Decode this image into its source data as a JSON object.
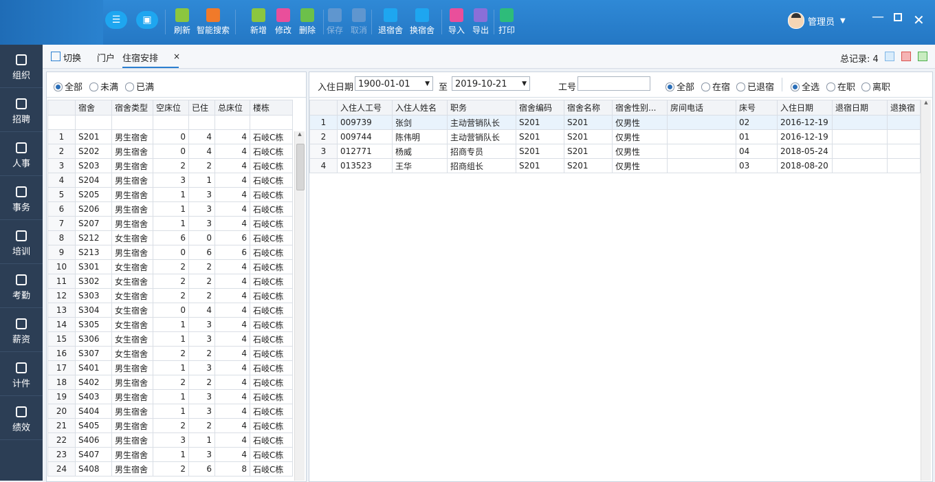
{
  "toolbar": {
    "items": [
      {
        "label": "刷新",
        "icon": "refresh-icon",
        "color": "#8cc63f",
        "enabled": true
      },
      {
        "label": "智能搜索",
        "icon": "filter-icon",
        "color": "#f07a2a",
        "enabled": true
      },
      {
        "label": "新增",
        "icon": "plus-icon",
        "color": "#8cc63f",
        "enabled": true
      },
      {
        "label": "修改",
        "icon": "pencil-icon",
        "color": "#e94f9b",
        "enabled": true
      },
      {
        "label": "删除",
        "icon": "x-icon",
        "color": "#6cc04a",
        "enabled": true
      },
      {
        "label": "保存",
        "icon": "save-icon",
        "color": "#5f96cf",
        "enabled": false
      },
      {
        "label": "取消",
        "icon": "cancel-icon",
        "color": "#5f96cf",
        "enabled": false
      },
      {
        "label": "退宿舍",
        "icon": "checkout-icon",
        "color": "#1ea6f0",
        "enabled": true
      },
      {
        "label": "换宿舍",
        "icon": "swap-icon",
        "color": "#1ea6f0",
        "enabled": true
      },
      {
        "label": "导入",
        "icon": "import-icon",
        "color": "#e94f9b",
        "enabled": true
      },
      {
        "label": "导出",
        "icon": "export-icon",
        "color": "#8a6fd8",
        "enabled": true
      },
      {
        "label": "打印",
        "icon": "print-icon",
        "color": "#2ebc7a",
        "enabled": true
      }
    ]
  },
  "user": {
    "name": "管理员"
  },
  "sidebar": {
    "items": [
      {
        "label": "组织"
      },
      {
        "label": "招聘"
      },
      {
        "label": "人事"
      },
      {
        "label": "事务"
      },
      {
        "label": "培训"
      },
      {
        "label": "考勤"
      },
      {
        "label": "薪资"
      },
      {
        "label": "计件"
      },
      {
        "label": "绩效"
      }
    ]
  },
  "tabs": {
    "switch": "切换",
    "portal": "门户",
    "active": "住宿安排",
    "close": "×"
  },
  "total": {
    "label": "总记录: 4"
  },
  "left": {
    "filter": {
      "all": "全部",
      "not_full": "未满",
      "full": "已满"
    },
    "columns": [
      "宿舍",
      "宿舍类型",
      "空床位",
      "已住",
      "总床位",
      "楼栋"
    ],
    "rows": [
      [
        "1",
        "S201",
        "男生宿舍",
        "0",
        "4",
        "4",
        "石岐C栋"
      ],
      [
        "2",
        "S202",
        "男生宿舍",
        "0",
        "4",
        "4",
        "石岐C栋"
      ],
      [
        "3",
        "S203",
        "男生宿舍",
        "2",
        "2",
        "4",
        "石岐C栋"
      ],
      [
        "4",
        "S204",
        "男生宿舍",
        "3",
        "1",
        "4",
        "石岐C栋"
      ],
      [
        "5",
        "S205",
        "男生宿舍",
        "1",
        "3",
        "4",
        "石岐C栋"
      ],
      [
        "6",
        "S206",
        "男生宿舍",
        "1",
        "3",
        "4",
        "石岐C栋"
      ],
      [
        "7",
        "S207",
        "男生宿舍",
        "1",
        "3",
        "4",
        "石岐C栋"
      ],
      [
        "8",
        "S212",
        "女生宿舍",
        "6",
        "0",
        "6",
        "石岐C栋"
      ],
      [
        "9",
        "S213",
        "男生宿舍",
        "0",
        "6",
        "6",
        "石岐C栋"
      ],
      [
        "10",
        "S301",
        "女生宿舍",
        "2",
        "2",
        "4",
        "石岐C栋"
      ],
      [
        "11",
        "S302",
        "女生宿舍",
        "2",
        "2",
        "4",
        "石岐C栋"
      ],
      [
        "12",
        "S303",
        "女生宿舍",
        "2",
        "2",
        "4",
        "石岐C栋"
      ],
      [
        "13",
        "S304",
        "女生宿舍",
        "0",
        "4",
        "4",
        "石岐C栋"
      ],
      [
        "14",
        "S305",
        "女生宿舍",
        "1",
        "3",
        "4",
        "石岐C栋"
      ],
      [
        "15",
        "S306",
        "女生宿舍",
        "1",
        "3",
        "4",
        "石岐C栋"
      ],
      [
        "16",
        "S307",
        "女生宿舍",
        "2",
        "2",
        "4",
        "石岐C栋"
      ],
      [
        "17",
        "S401",
        "男生宿舍",
        "1",
        "3",
        "4",
        "石岐C栋"
      ],
      [
        "18",
        "S402",
        "男生宿舍",
        "2",
        "2",
        "4",
        "石岐C栋"
      ],
      [
        "19",
        "S403",
        "男生宿舍",
        "1",
        "3",
        "4",
        "石岐C栋"
      ],
      [
        "20",
        "S404",
        "男生宿舍",
        "1",
        "3",
        "4",
        "石岐C栋"
      ],
      [
        "21",
        "S405",
        "男生宿舍",
        "2",
        "2",
        "4",
        "石岐C栋"
      ],
      [
        "22",
        "S406",
        "男生宿舍",
        "3",
        "1",
        "4",
        "石岐C栋"
      ],
      [
        "23",
        "S407",
        "男生宿舍",
        "1",
        "3",
        "4",
        "石岐C栋"
      ],
      [
        "24",
        "S408",
        "男生宿舍",
        "2",
        "6",
        "8",
        "石岐C栋"
      ]
    ]
  },
  "right": {
    "filter": {
      "date_label": "入住日期",
      "date_from": "1900-01-01",
      "to_label": "至",
      "date_to": "2019-10-21",
      "emp_label": "工号",
      "emp_value": "",
      "r1": "全部",
      "r2": "在宿",
      "r3": "已退宿",
      "r4": "全选",
      "r5": "在职",
      "r6": "离职"
    },
    "columns": [
      "入住人工号",
      "入住人姓名",
      "职务",
      "宿舍编码",
      "宿舍名称",
      "宿舍性别...",
      "房间电话",
      "床号",
      "入住日期",
      "退宿日期",
      "退换宿"
    ],
    "rows": [
      [
        "1",
        "009739",
        "张剑",
        "主动营销队长",
        "S201",
        "S201",
        "仅男性",
        "",
        "02",
        "2016-12-19",
        "",
        ""
      ],
      [
        "2",
        "009744",
        "陈伟明",
        "主动营销队长",
        "S201",
        "S201",
        "仅男性",
        "",
        "01",
        "2016-12-19",
        "",
        ""
      ],
      [
        "3",
        "012771",
        "杨威",
        "招商专员",
        "S201",
        "S201",
        "仅男性",
        "",
        "04",
        "2018-05-24",
        "",
        ""
      ],
      [
        "4",
        "013523",
        "王华",
        "招商组长",
        "S201",
        "S201",
        "仅男性",
        "",
        "03",
        "2018-08-20",
        "",
        ""
      ]
    ]
  }
}
